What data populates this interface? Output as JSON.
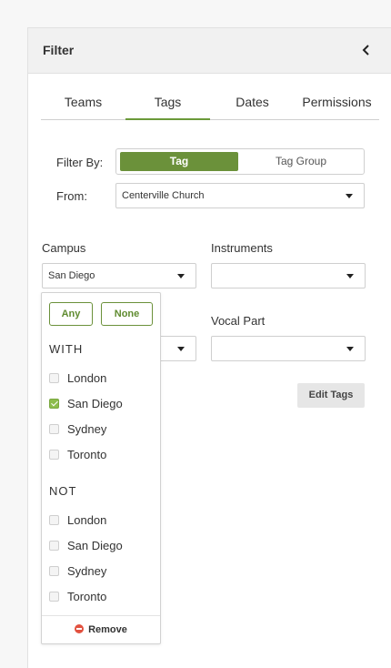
{
  "panel": {
    "title": "Filter"
  },
  "tabs": [
    {
      "label": "Teams",
      "active": false
    },
    {
      "label": "Tags",
      "active": true
    },
    {
      "label": "Dates",
      "active": false
    },
    {
      "label": "Permissions",
      "active": false
    }
  ],
  "filter_by": {
    "label": "Filter By:",
    "options": [
      {
        "label": "Tag",
        "active": true
      },
      {
        "label": "Tag Group",
        "active": false
      }
    ]
  },
  "from": {
    "label": "From:",
    "value": "Centerville Church"
  },
  "campus": {
    "label": "Campus",
    "value": "San Diego"
  },
  "instruments": {
    "label": "Instruments",
    "value": ""
  },
  "vocal_part": {
    "label": "Vocal Part",
    "value": ""
  },
  "edit_tags_label": "Edit Tags",
  "dropdown": {
    "any_label": "Any",
    "none_label": "None",
    "with_title": "WITH",
    "with_options": [
      {
        "label": "London",
        "checked": false
      },
      {
        "label": "San Diego",
        "checked": true
      },
      {
        "label": "Sydney",
        "checked": false
      },
      {
        "label": "Toronto",
        "checked": false
      }
    ],
    "not_title": "NOT",
    "not_options": [
      {
        "label": "London",
        "checked": false
      },
      {
        "label": "San Diego",
        "checked": false
      },
      {
        "label": "Sydney",
        "checked": false
      },
      {
        "label": "Toronto",
        "checked": false
      }
    ],
    "remove_label": "Remove"
  },
  "colors": {
    "accent": "#6b913a",
    "check": "#8dbd4d",
    "remove": "#e2513f"
  }
}
